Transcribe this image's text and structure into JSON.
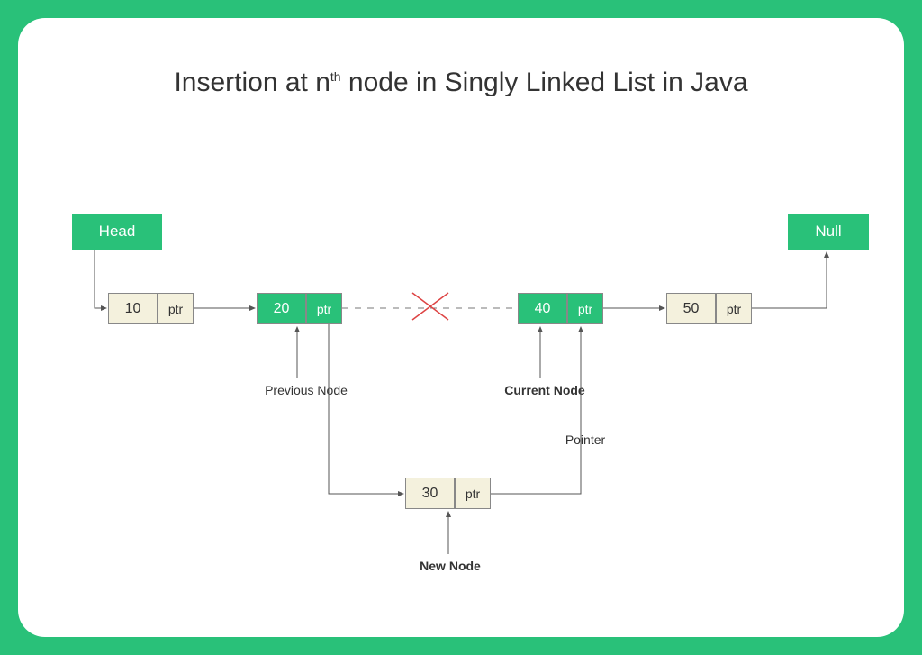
{
  "title_prefix": "Insertion at n",
  "title_th": "th",
  "title_suffix": " node in Singly Linked List in Java",
  "head_label": "Head",
  "null_label": "Null",
  "ptr_label": "ptr",
  "nodes": {
    "n1": "10",
    "n2": "20",
    "n3": "40",
    "n4": "50",
    "new": "30"
  },
  "labels": {
    "previous": "Previous Node",
    "current": "Current Node",
    "pointer": "Pointer",
    "newnode": "New Node"
  }
}
